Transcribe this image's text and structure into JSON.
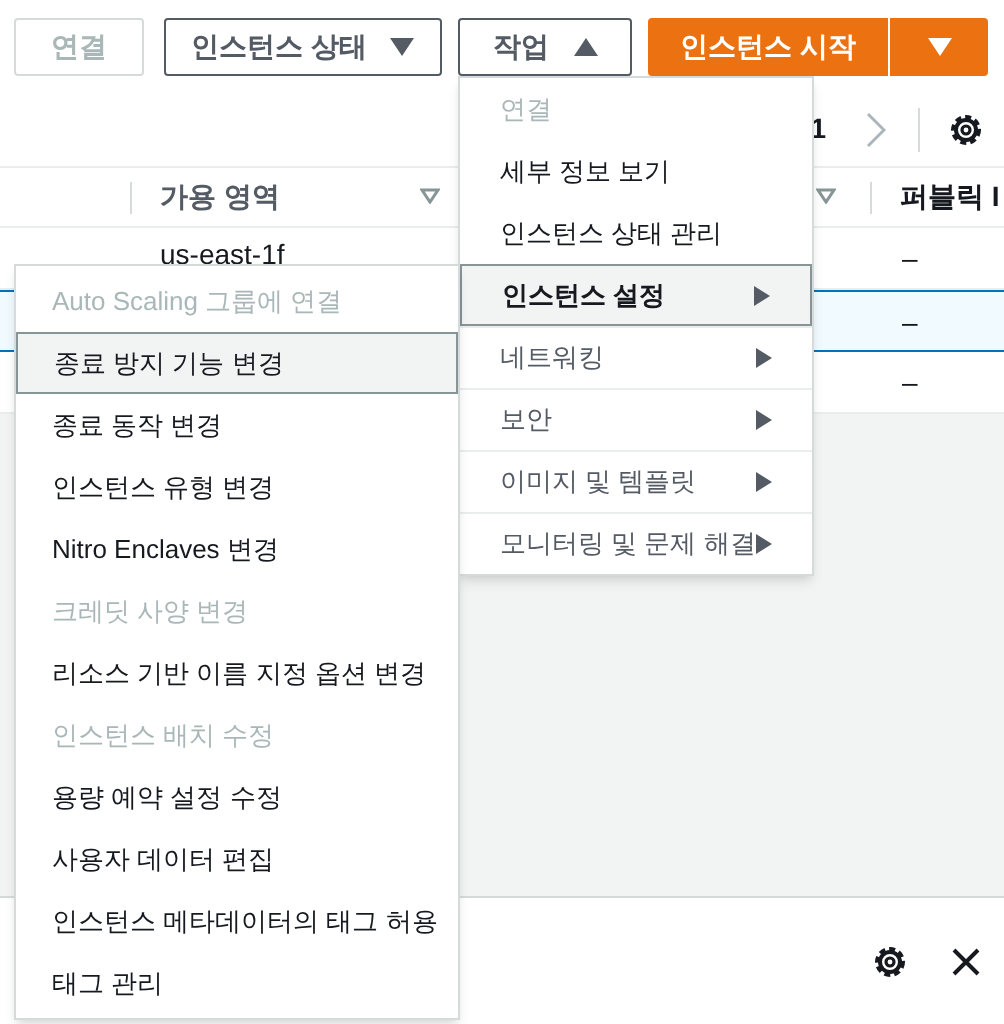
{
  "toolbar": {
    "buttons": [
      {
        "label": "연결",
        "kind": "plain",
        "disabled": true
      },
      {
        "label": "인스턴스 상태",
        "kind": "dropdown",
        "disabled": false,
        "expanded": false
      },
      {
        "label": "작업",
        "kind": "dropdown",
        "disabled": false,
        "expanded": true
      },
      {
        "label": "인스턴스 시작",
        "kind": "primary"
      },
      {
        "kind": "primary-split",
        "expanded": false
      }
    ]
  },
  "pagination": {
    "page": "1"
  },
  "table": {
    "columns": [
      {
        "label": "가용 영역"
      },
      {
        "label": "퍼블릭 I"
      }
    ],
    "rows": [
      {
        "availability_zone": "us-east-1f",
        "public_ip": "–",
        "selected": false
      },
      {
        "public_ip": "–",
        "selected": true
      },
      {
        "public_ip": "–",
        "selected": false
      }
    ]
  },
  "actions_menu": {
    "items": [
      {
        "label": "연결",
        "disabled": true,
        "submenu": false,
        "selected": false
      },
      {
        "label": "세부 정보 보기",
        "disabled": false,
        "submenu": false,
        "selected": false
      },
      {
        "label": "인스턴스 상태 관리",
        "disabled": false,
        "submenu": false,
        "selected": false
      },
      {
        "label": "인스턴스 설정",
        "disabled": false,
        "submenu": true,
        "selected": true
      },
      {
        "label": "네트워킹",
        "disabled": false,
        "submenu": true,
        "selected": false
      },
      {
        "label": "보안",
        "disabled": false,
        "submenu": true,
        "selected": false
      },
      {
        "label": "이미지 및 템플릿",
        "disabled": false,
        "submenu": true,
        "selected": false
      },
      {
        "label": "모니터링 및 문제 해결",
        "disabled": false,
        "submenu": true,
        "selected": false
      }
    ]
  },
  "settings_submenu": {
    "items": [
      {
        "label": "Auto Scaling 그룹에 연결",
        "disabled": true,
        "selected": false
      },
      {
        "label": "종료 방지 기능 변경",
        "disabled": false,
        "selected": true
      },
      {
        "label": "종료 동작 변경",
        "disabled": false,
        "selected": false
      },
      {
        "label": "인스턴스 유형 변경",
        "disabled": false,
        "selected": false
      },
      {
        "label": "Nitro Enclaves 변경",
        "disabled": false,
        "selected": false
      },
      {
        "label": "크레딧 사양 변경",
        "disabled": true,
        "selected": false
      },
      {
        "label": "리소스 기반 이름 지정 옵션 변경",
        "disabled": false,
        "selected": false
      },
      {
        "label": "인스턴스 배치 수정",
        "disabled": true,
        "selected": false
      },
      {
        "label": "용량 예약 설정 수정",
        "disabled": false,
        "selected": false
      },
      {
        "label": "사용자 데이터 편집",
        "disabled": false,
        "selected": false
      },
      {
        "label": "인스턴스 메타데이터의 태그 허용",
        "disabled": false,
        "selected": false
      },
      {
        "label": "태그 관리",
        "disabled": false,
        "selected": false
      }
    ]
  }
}
